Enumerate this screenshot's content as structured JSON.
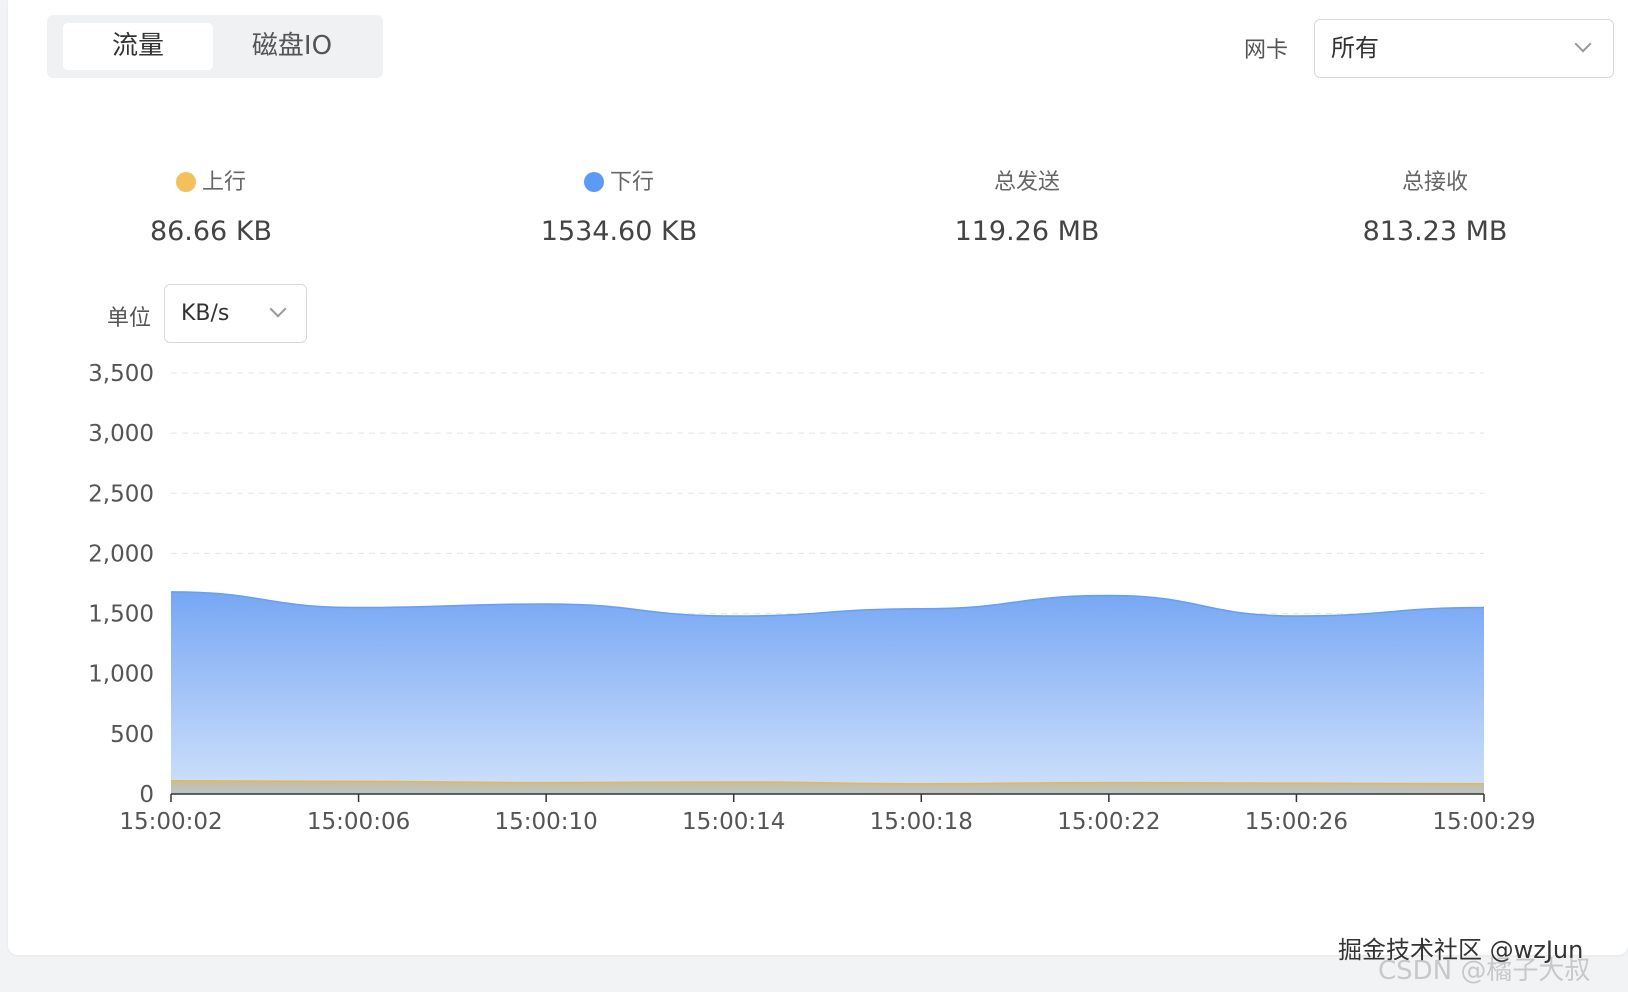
{
  "tabs": [
    {
      "label": "流量",
      "active": true
    },
    {
      "label": "磁盘IO",
      "active": false
    }
  ],
  "nic": {
    "label": "网卡",
    "value": "所有"
  },
  "stats": [
    {
      "label": "上行",
      "value": "86.66 KB",
      "dot_color": "#f2c15c"
    },
    {
      "label": "下行",
      "value": "1534.60 KB",
      "dot_color": "#5b9bf5"
    },
    {
      "label": "总发送",
      "value": "119.26 MB"
    },
    {
      "label": "总接收",
      "value": "813.23 MB"
    }
  ],
  "unit": {
    "label": "单位",
    "value": "KB/s"
  },
  "chart_data": {
    "type": "area",
    "title": "",
    "xlabel": "",
    "ylabel": "",
    "x": [
      "15:00:02",
      "15:00:06",
      "15:00:10",
      "15:00:14",
      "15:00:18",
      "15:00:22",
      "15:00:26",
      "15:00:29"
    ],
    "yticks": [
      "0",
      "500",
      "1,000",
      "1,500",
      "2,000",
      "2,500",
      "3,000",
      "3,500"
    ],
    "ylim": [
      0,
      3500
    ],
    "grid": true,
    "series": [
      {
        "name": "下行",
        "color": "#5b9bf5",
        "values": [
          1680,
          1550,
          1580,
          1480,
          1540,
          1650,
          1480,
          1550
        ]
      },
      {
        "name": "上行",
        "color": "#f2c15c",
        "values": [
          110,
          105,
          95,
          100,
          85,
          95,
          90,
          85
        ]
      }
    ]
  },
  "watermark": {
    "line1": "掘金技术社区 @wzJun",
    "line2": "CSDN @橘子大叔"
  }
}
